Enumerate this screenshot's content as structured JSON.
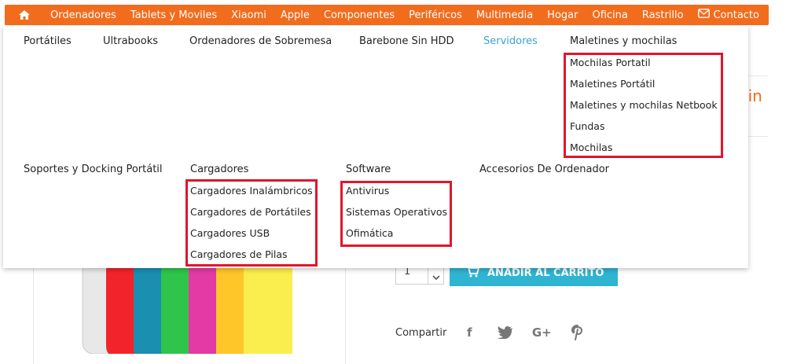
{
  "topnav": {
    "items": [
      "Ordenadores",
      "Tablets y Moviles",
      "Xiaomi",
      "Apple",
      "Componentes",
      "Periféricos",
      "Multimedia",
      "Hogar",
      "Oficina",
      "Rastrillo"
    ],
    "contact": "Contacto"
  },
  "mega": {
    "row1": [
      "Portátiles",
      "Ultrabooks",
      "Ordenadores de Sobremesa",
      "Barebone Sin HDD",
      "Servidores",
      "Maletines y mochilas"
    ],
    "maletines_sub": [
      "Mochilas Portatil",
      "Maletines Portátil",
      "Maletines y mochilas Netbook",
      "Fundas",
      "Mochilas"
    ],
    "row2": [
      "Soportes y Docking Portátil",
      "Cargadores",
      "Software",
      "Accesorios De Ordenador"
    ],
    "cargadores_sub": [
      "Cargadores Inalámbricos",
      "Cargadores de Portátiles",
      "Cargadores USB",
      "Cargadores de Pilas"
    ],
    "software_sub": [
      "Antivirus",
      "Sistemas Operativos",
      "Ofimática"
    ]
  },
  "background": {
    "title_fragment": "kin",
    "qty_value": "1",
    "add_to_cart": "AÑADIR AL CARRITO",
    "share_label": "Compartir"
  },
  "colors": {
    "nav": "#f26c1d",
    "active": "#3aa3d4",
    "cart": "#2fb5d2",
    "highlight": "#e0162b"
  },
  "icons": [
    "home-icon",
    "envelope-icon",
    "cart-icon",
    "chevron-down-icon",
    "facebook-icon",
    "twitter-icon",
    "googleplus-icon",
    "pinterest-icon"
  ]
}
